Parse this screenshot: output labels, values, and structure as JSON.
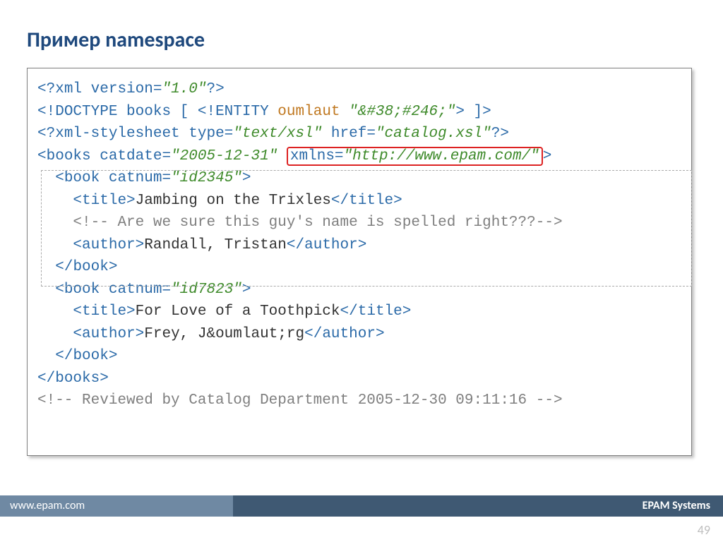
{
  "title": "Пример namespace",
  "footer": {
    "url": "www.epam.com",
    "company": "EPAM Systems"
  },
  "page_number": "49",
  "code": {
    "l1": {
      "open": "<?",
      "xml": "xml",
      "version_attr": " version",
      "eq": "=",
      "version_val": "\"1.0\"",
      "close": "?>"
    },
    "l2": {
      "open": "<!",
      "doctype": "DOCTYPE",
      "books": " books [ ",
      "entopen": "<!",
      "entity": "ENTITY",
      "entname": " oumlaut ",
      "entval": "\"&#38;#246;\"",
      "entclose": ">",
      "dtclose": " ]>"
    },
    "l3": {
      "open": "<?",
      "pi": "xml-stylesheet",
      "type_attr": " type",
      "eq1": "=",
      "type_val": "\"text/xsl\"",
      "href_attr": " href",
      "eq2": "=",
      "href_val": "\"catalog.xsl\"",
      "close": "?>"
    },
    "l4": {
      "open": "<",
      "books": "books",
      "catdate_attr": " catdate",
      "eq1": "=",
      "catdate_val": "\"2005-12-31\"",
      "sp": " ",
      "xmlns_attr": "xmlns",
      "eq2": "=",
      "xmlns_val": "\"http://www.epam.com/\"",
      "close": ">"
    },
    "l5": {
      "indent": "  ",
      "open": "<",
      "book": "book",
      "catnum_attr": " catnum",
      "eq": "=",
      "catnum_val": "\"id2345\"",
      "close": ">"
    },
    "l6": {
      "indent": "    ",
      "open": "<",
      "title": "title",
      "gt": ">",
      "text": "Jambing on the Trixles",
      "close_open": "</",
      "close_title": "title",
      "close_gt": ">"
    },
    "l7": {
      "indent": "    ",
      "open": "<!--",
      "text": " Are we sure this guy's name is spelled right???",
      "close": "-->"
    },
    "l8": {
      "indent": "    ",
      "open": "<",
      "author": "author",
      "gt": ">",
      "text": "Randall, Tristan",
      "close_open": "</",
      "close_author": "author",
      "close_gt": ">"
    },
    "l9": {
      "indent": "  ",
      "open": "</",
      "book": "book",
      "close": ">"
    },
    "l10": {
      "indent": "  ",
      "open": "<",
      "book": "book",
      "catnum_attr": " catnum",
      "eq": "=",
      "catnum_val": "\"id7823\"",
      "close": ">"
    },
    "l11": {
      "indent": "    ",
      "open": "<",
      "title": "title",
      "gt": ">",
      "text": "For Love of a Toothpick",
      "close_open": "</",
      "close_title": "title",
      "close_gt": ">"
    },
    "l12": {
      "indent": "    ",
      "open": "<",
      "author": "author",
      "gt": ">",
      "text": "Frey, J&oumlaut;rg",
      "close_open": "</",
      "close_author": "author",
      "close_gt": ">"
    },
    "l13": {
      "indent": "  ",
      "open": "</",
      "book": "book",
      "close": ">"
    },
    "l14": {
      "open": "</",
      "books": "books",
      "close": ">"
    },
    "l15": {
      "open": "<!--",
      "text": " Reviewed by Catalog Department 2005-12-30 09:11:16 ",
      "close": "-->"
    }
  }
}
